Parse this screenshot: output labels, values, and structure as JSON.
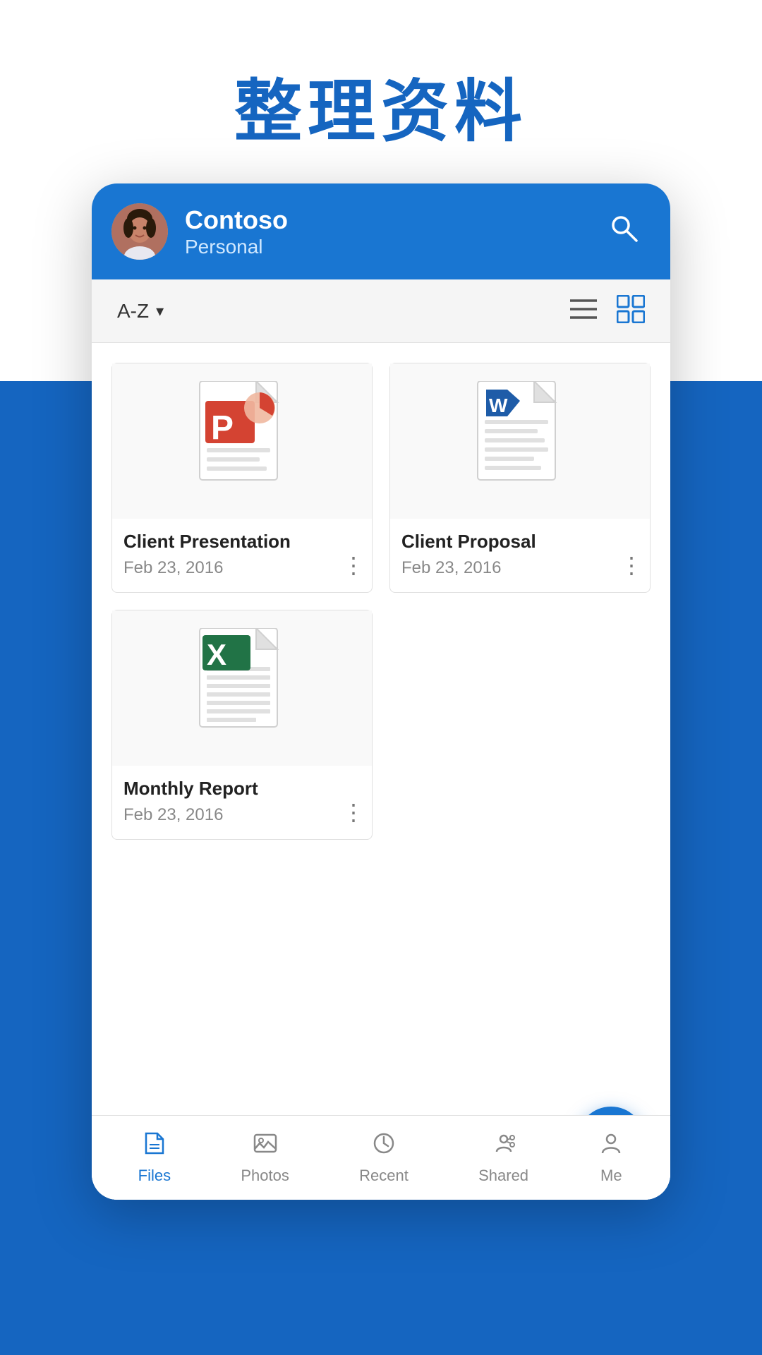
{
  "page": {
    "title": "整理资料",
    "bg_color_blue": "#1976D2",
    "bg_color_white": "#ffffff"
  },
  "header": {
    "account_name": "Contoso",
    "account_type": "Personal",
    "search_label": "search"
  },
  "toolbar": {
    "sort_label": "A-Z",
    "sort_icon": "▾",
    "list_icon": "☰",
    "grid_icon": "⊞"
  },
  "files": [
    {
      "id": "file-1",
      "name": "Client Presentation",
      "date": "Feb 23, 2016",
      "type": "pptx",
      "app_color": "#D44332"
    },
    {
      "id": "file-2",
      "name": "Client Proposal",
      "date": "Feb 23, 2016",
      "type": "docx",
      "app_color": "#1E5CA8"
    },
    {
      "id": "file-3",
      "name": "Monthly Report",
      "date": "Feb 23, 2016",
      "type": "xlsx",
      "app_color": "#217346"
    }
  ],
  "fab": {
    "label": "+"
  },
  "bottom_nav": {
    "items": [
      {
        "id": "files",
        "label": "Files",
        "active": true
      },
      {
        "id": "photos",
        "label": "Photos",
        "active": false
      },
      {
        "id": "recent",
        "label": "Recent",
        "active": false
      },
      {
        "id": "shared",
        "label": "Shared",
        "active": false
      },
      {
        "id": "me",
        "label": "Me",
        "active": false
      }
    ]
  }
}
